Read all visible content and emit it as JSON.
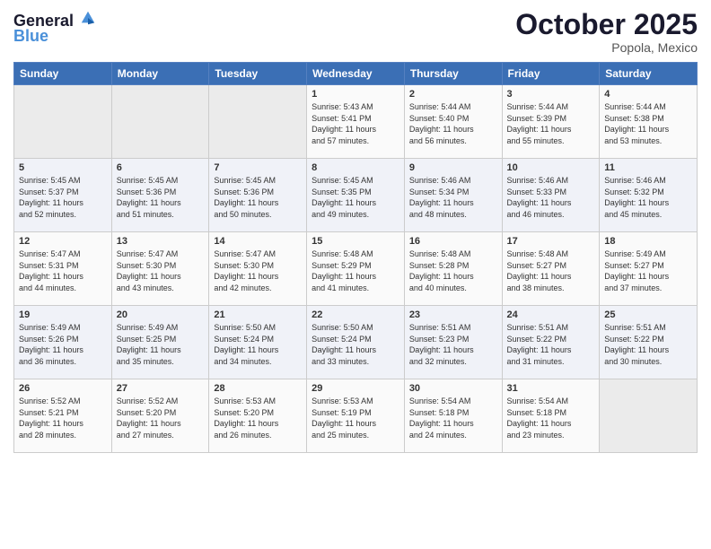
{
  "header": {
    "logo_line1": "General",
    "logo_line2": "Blue",
    "month": "October 2025",
    "location": "Popola, Mexico"
  },
  "weekdays": [
    "Sunday",
    "Monday",
    "Tuesday",
    "Wednesday",
    "Thursday",
    "Friday",
    "Saturday"
  ],
  "weeks": [
    [
      {
        "num": "",
        "info": ""
      },
      {
        "num": "",
        "info": ""
      },
      {
        "num": "",
        "info": ""
      },
      {
        "num": "1",
        "info": "Sunrise: 5:43 AM\nSunset: 5:41 PM\nDaylight: 11 hours\nand 57 minutes."
      },
      {
        "num": "2",
        "info": "Sunrise: 5:44 AM\nSunset: 5:40 PM\nDaylight: 11 hours\nand 56 minutes."
      },
      {
        "num": "3",
        "info": "Sunrise: 5:44 AM\nSunset: 5:39 PM\nDaylight: 11 hours\nand 55 minutes."
      },
      {
        "num": "4",
        "info": "Sunrise: 5:44 AM\nSunset: 5:38 PM\nDaylight: 11 hours\nand 53 minutes."
      }
    ],
    [
      {
        "num": "5",
        "info": "Sunrise: 5:45 AM\nSunset: 5:37 PM\nDaylight: 11 hours\nand 52 minutes."
      },
      {
        "num": "6",
        "info": "Sunrise: 5:45 AM\nSunset: 5:36 PM\nDaylight: 11 hours\nand 51 minutes."
      },
      {
        "num": "7",
        "info": "Sunrise: 5:45 AM\nSunset: 5:36 PM\nDaylight: 11 hours\nand 50 minutes."
      },
      {
        "num": "8",
        "info": "Sunrise: 5:45 AM\nSunset: 5:35 PM\nDaylight: 11 hours\nand 49 minutes."
      },
      {
        "num": "9",
        "info": "Sunrise: 5:46 AM\nSunset: 5:34 PM\nDaylight: 11 hours\nand 48 minutes."
      },
      {
        "num": "10",
        "info": "Sunrise: 5:46 AM\nSunset: 5:33 PM\nDaylight: 11 hours\nand 46 minutes."
      },
      {
        "num": "11",
        "info": "Sunrise: 5:46 AM\nSunset: 5:32 PM\nDaylight: 11 hours\nand 45 minutes."
      }
    ],
    [
      {
        "num": "12",
        "info": "Sunrise: 5:47 AM\nSunset: 5:31 PM\nDaylight: 11 hours\nand 44 minutes."
      },
      {
        "num": "13",
        "info": "Sunrise: 5:47 AM\nSunset: 5:30 PM\nDaylight: 11 hours\nand 43 minutes."
      },
      {
        "num": "14",
        "info": "Sunrise: 5:47 AM\nSunset: 5:30 PM\nDaylight: 11 hours\nand 42 minutes."
      },
      {
        "num": "15",
        "info": "Sunrise: 5:48 AM\nSunset: 5:29 PM\nDaylight: 11 hours\nand 41 minutes."
      },
      {
        "num": "16",
        "info": "Sunrise: 5:48 AM\nSunset: 5:28 PM\nDaylight: 11 hours\nand 40 minutes."
      },
      {
        "num": "17",
        "info": "Sunrise: 5:48 AM\nSunset: 5:27 PM\nDaylight: 11 hours\nand 38 minutes."
      },
      {
        "num": "18",
        "info": "Sunrise: 5:49 AM\nSunset: 5:27 PM\nDaylight: 11 hours\nand 37 minutes."
      }
    ],
    [
      {
        "num": "19",
        "info": "Sunrise: 5:49 AM\nSunset: 5:26 PM\nDaylight: 11 hours\nand 36 minutes."
      },
      {
        "num": "20",
        "info": "Sunrise: 5:49 AM\nSunset: 5:25 PM\nDaylight: 11 hours\nand 35 minutes."
      },
      {
        "num": "21",
        "info": "Sunrise: 5:50 AM\nSunset: 5:24 PM\nDaylight: 11 hours\nand 34 minutes."
      },
      {
        "num": "22",
        "info": "Sunrise: 5:50 AM\nSunset: 5:24 PM\nDaylight: 11 hours\nand 33 minutes."
      },
      {
        "num": "23",
        "info": "Sunrise: 5:51 AM\nSunset: 5:23 PM\nDaylight: 11 hours\nand 32 minutes."
      },
      {
        "num": "24",
        "info": "Sunrise: 5:51 AM\nSunset: 5:22 PM\nDaylight: 11 hours\nand 31 minutes."
      },
      {
        "num": "25",
        "info": "Sunrise: 5:51 AM\nSunset: 5:22 PM\nDaylight: 11 hours\nand 30 minutes."
      }
    ],
    [
      {
        "num": "26",
        "info": "Sunrise: 5:52 AM\nSunset: 5:21 PM\nDaylight: 11 hours\nand 28 minutes."
      },
      {
        "num": "27",
        "info": "Sunrise: 5:52 AM\nSunset: 5:20 PM\nDaylight: 11 hours\nand 27 minutes."
      },
      {
        "num": "28",
        "info": "Sunrise: 5:53 AM\nSunset: 5:20 PM\nDaylight: 11 hours\nand 26 minutes."
      },
      {
        "num": "29",
        "info": "Sunrise: 5:53 AM\nSunset: 5:19 PM\nDaylight: 11 hours\nand 25 minutes."
      },
      {
        "num": "30",
        "info": "Sunrise: 5:54 AM\nSunset: 5:18 PM\nDaylight: 11 hours\nand 24 minutes."
      },
      {
        "num": "31",
        "info": "Sunrise: 5:54 AM\nSunset: 5:18 PM\nDaylight: 11 hours\nand 23 minutes."
      },
      {
        "num": "",
        "info": ""
      }
    ]
  ]
}
